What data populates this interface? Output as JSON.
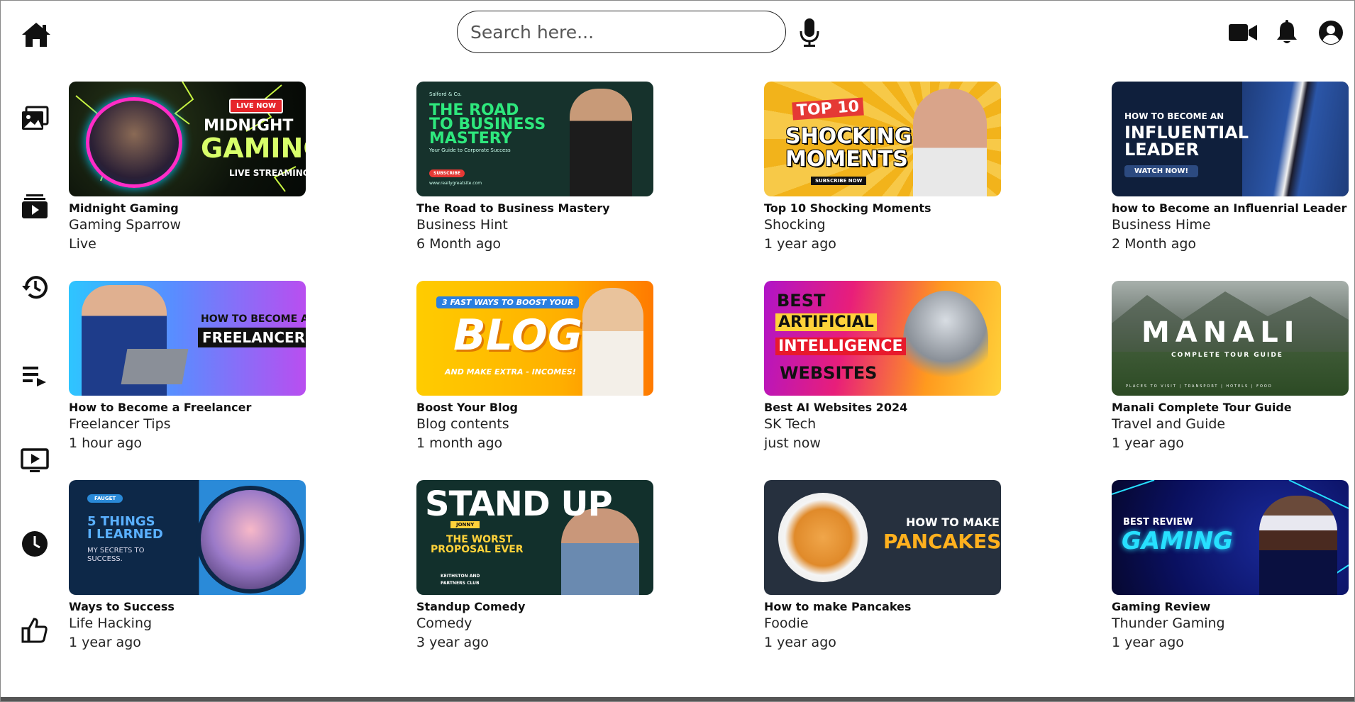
{
  "header": {
    "search": {
      "placeholder": "Search here...",
      "value": ""
    }
  },
  "sidebar": {
    "items": [
      {
        "icon": "photo-gallery-icon"
      },
      {
        "icon": "subscriptions-icon"
      },
      {
        "icon": "history-icon"
      },
      {
        "icon": "playlist-icon"
      },
      {
        "icon": "your-videos-icon"
      },
      {
        "icon": "watch-later-icon"
      },
      {
        "icon": "liked-videos-icon"
      }
    ]
  },
  "videos": [
    {
      "title": "Midnight Gaming",
      "channel": "Gaming Sparrow",
      "time": "Live",
      "thumb": {
        "badge": "LIVE NOW",
        "line1": "MIDNIGHT",
        "line2": "GAMING",
        "line3": "LIVE STREAMING"
      }
    },
    {
      "title": "The Road to Business Mastery",
      "channel": "Business Hint",
      "time": "6 Month ago",
      "thumb": {
        "brand": "Salford & Co.",
        "line1": "THE ROAD",
        "line2": "TO BUSINESS",
        "line3": "MASTERY",
        "sub": "Your Guide to Corporate Success",
        "button": "SUBSCRIBE",
        "url": "www.reallygreatsite.com"
      }
    },
    {
      "title": "Top 10 Shocking Moments",
      "channel": "Shocking",
      "time": "1 year ago",
      "thumb": {
        "line1": "TOP 10",
        "line2": "SHOCKING",
        "line3": "MOMENTS",
        "button": "SUBSCRIBE NOW"
      }
    },
    {
      "title": "how to Become an Influenrial Leader",
      "channel": "Business Hime",
      "time": "2 Month ago",
      "thumb": {
        "line1": "HOW TO BECOME AN",
        "line2": "INFLUENTIAL",
        "line3": "LEADER",
        "button": "WATCH NOW!"
      }
    },
    {
      "title": "How to Become a Freelancer",
      "channel": "Freelancer Tips",
      "time": "1 hour ago",
      "thumb": {
        "line1": "HOW TO BECOME A",
        "line2": "FREELANCER"
      }
    },
    {
      "title": "Boost Your Blog",
      "channel": "Blog contents",
      "time": "1 month ago",
      "thumb": {
        "line1": "3 FAST WAYS TO BOOST YOUR",
        "line2": "BLOG",
        "line3": "AND MAKE EXTRA - INCOMES!"
      }
    },
    {
      "title": "Best AI Websites 2024",
      "channel": "SK Tech",
      "time": "just now",
      "thumb": {
        "line1": "BEST",
        "line2": "ARTIFICIAL",
        "line3": "INTELLIGENCE",
        "line4": "WEBSITES"
      }
    },
    {
      "title": "Manali Complete Tour Guide",
      "channel": "Travel and Guide",
      "time": "1 year ago",
      "thumb": {
        "line1": "MANALI",
        "line2": "COMPLETE TOUR GUIDE",
        "line3": "PLACES TO VISIT | TRANSPORT | HOTELS | FOOD"
      }
    },
    {
      "title": "Ways to Success",
      "channel": "Life Hacking",
      "time": "1 year ago",
      "thumb": {
        "badge": "FAUGET",
        "line1": "5 THINGS",
        "line2": "I LEARNED",
        "line3": "MY SECRETS TO",
        "line4": "SUCCESS."
      }
    },
    {
      "title": "Standup Comedy",
      "channel": "Comedy",
      "time": "3 year ago",
      "thumb": {
        "line1": "STAND UP",
        "badge": "JONNY",
        "line2": "THE WORST",
        "line3": "PROPOSAL EVER",
        "club1": "KEITHSTON AND",
        "club2": "PARTNERS CLUB"
      }
    },
    {
      "title": "How to make Pancakes",
      "channel": "Foodie",
      "time": "1 year ago",
      "thumb": {
        "line1": "HOW TO MAKE",
        "line2": "PANCAKES"
      }
    },
    {
      "title": "Gaming Review",
      "channel": "Thunder Gaming",
      "time": "1 year ago",
      "thumb": {
        "line1": "BEST REVIEW",
        "line2": "GAMING"
      }
    }
  ]
}
